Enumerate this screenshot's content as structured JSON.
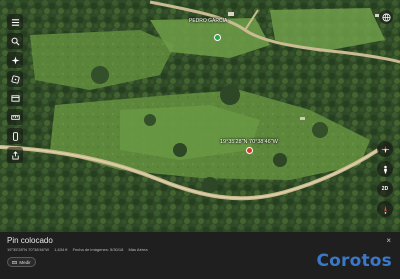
{
  "status_bar": {
    "time": "",
    "right": ""
  },
  "map": {
    "place_label": "PEDRO GARCIA",
    "coordinates": "19°35'28\"N 70°38'46\"W"
  },
  "panel": {
    "title": "Pin colocado",
    "coords": "19°35'28\"N 70°38'46\"W",
    "elevation": "1,634 ft",
    "imagery_date": "Fecha de imágenes: 5/30/18",
    "source": "Más Aérea",
    "measure_label": "Medir",
    "close_label": "×"
  },
  "right_controls": {
    "view_mode": "2D"
  },
  "watermark": "Corotos",
  "colors": {
    "pin": "#d23b2c",
    "place_dot": "#2ea44f",
    "watermark": "#3b78c8",
    "panel_bg": "#1f1f1f"
  },
  "icons": [
    "menu-icon",
    "search-icon",
    "voyager-icon",
    "dice-icon",
    "projects-icon",
    "measure-icon",
    "phone-icon",
    "share-icon",
    "globe-icon",
    "compass-icon",
    "person-icon",
    "view-mode",
    "location-icon",
    "close-icon"
  ]
}
